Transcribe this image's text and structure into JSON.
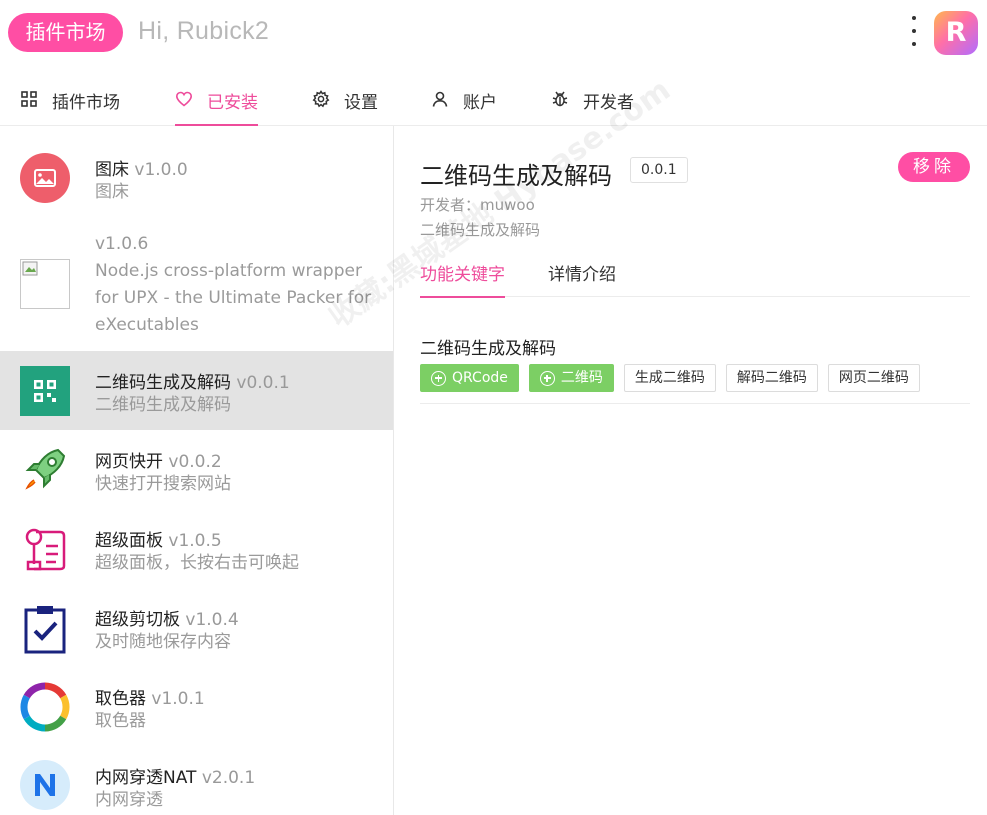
{
  "header": {
    "market_pill": "插件市场",
    "greeting": "Hi, Rubick2",
    "logo_letter": "R"
  },
  "tabs": [
    {
      "label": "插件市场",
      "icon": "grid-icon"
    },
    {
      "label": "已安装",
      "icon": "heart-icon",
      "active": true
    },
    {
      "label": "设置",
      "icon": "gear-icon"
    },
    {
      "label": "账户",
      "icon": "user-icon"
    },
    {
      "label": "开发者",
      "icon": "bug-icon"
    }
  ],
  "plugins": [
    {
      "name": "图床",
      "version": "v1.0.0",
      "desc": "图床",
      "icon": "image-icon"
    },
    {
      "name": "",
      "version": "v1.0.6",
      "desc": "Node.js cross-platform wrapper for UPX - the Ultimate Packer for eXecutables",
      "icon": "broken-image-icon"
    },
    {
      "name": "二维码生成及解码",
      "version": "v0.0.1",
      "desc": "二维码生成及解码",
      "icon": "qrcode-icon",
      "selected": true
    },
    {
      "name": "网页快开",
      "version": "v0.0.2",
      "desc": "快速打开搜索网站",
      "icon": "rocket-icon"
    },
    {
      "name": "超级面板",
      "version": "v1.0.5",
      "desc": "超级面板，长按右击可唤起",
      "icon": "panel-icon"
    },
    {
      "name": "超级剪切板",
      "version": "v1.0.4",
      "desc": "及时随地保存内容",
      "icon": "clipboard-icon"
    },
    {
      "name": "取色器",
      "version": "v1.0.1",
      "desc": "取色器",
      "icon": "color-ring-icon"
    },
    {
      "name": "内网穿透NAT",
      "version": "v2.0.1",
      "desc": "内网穿透",
      "icon": "n-letter-icon"
    }
  ],
  "detail": {
    "title": "二维码生成及解码",
    "version": "0.0.1",
    "remove_label": "移除",
    "developer": "开发者：muwoo",
    "description": "二维码生成及解码",
    "tabs": [
      "功能关键字",
      "详情介绍"
    ],
    "keyword_group_title": "二维码生成及解码",
    "keywords": [
      {
        "label": "QRCode",
        "type": "green"
      },
      {
        "label": "二维码",
        "type": "green"
      },
      {
        "label": "生成二维码",
        "type": "plain"
      },
      {
        "label": "解码二维码",
        "type": "plain"
      },
      {
        "label": "网页二维码",
        "type": "plain"
      }
    ]
  },
  "watermark": "收藏:黑域基地 Hybase.com",
  "colors": {
    "accent": "#ee4c9b",
    "pill": "#ff4ea4",
    "keyword_green": "#7ccf64",
    "selected_row": "#e3e3e3"
  }
}
